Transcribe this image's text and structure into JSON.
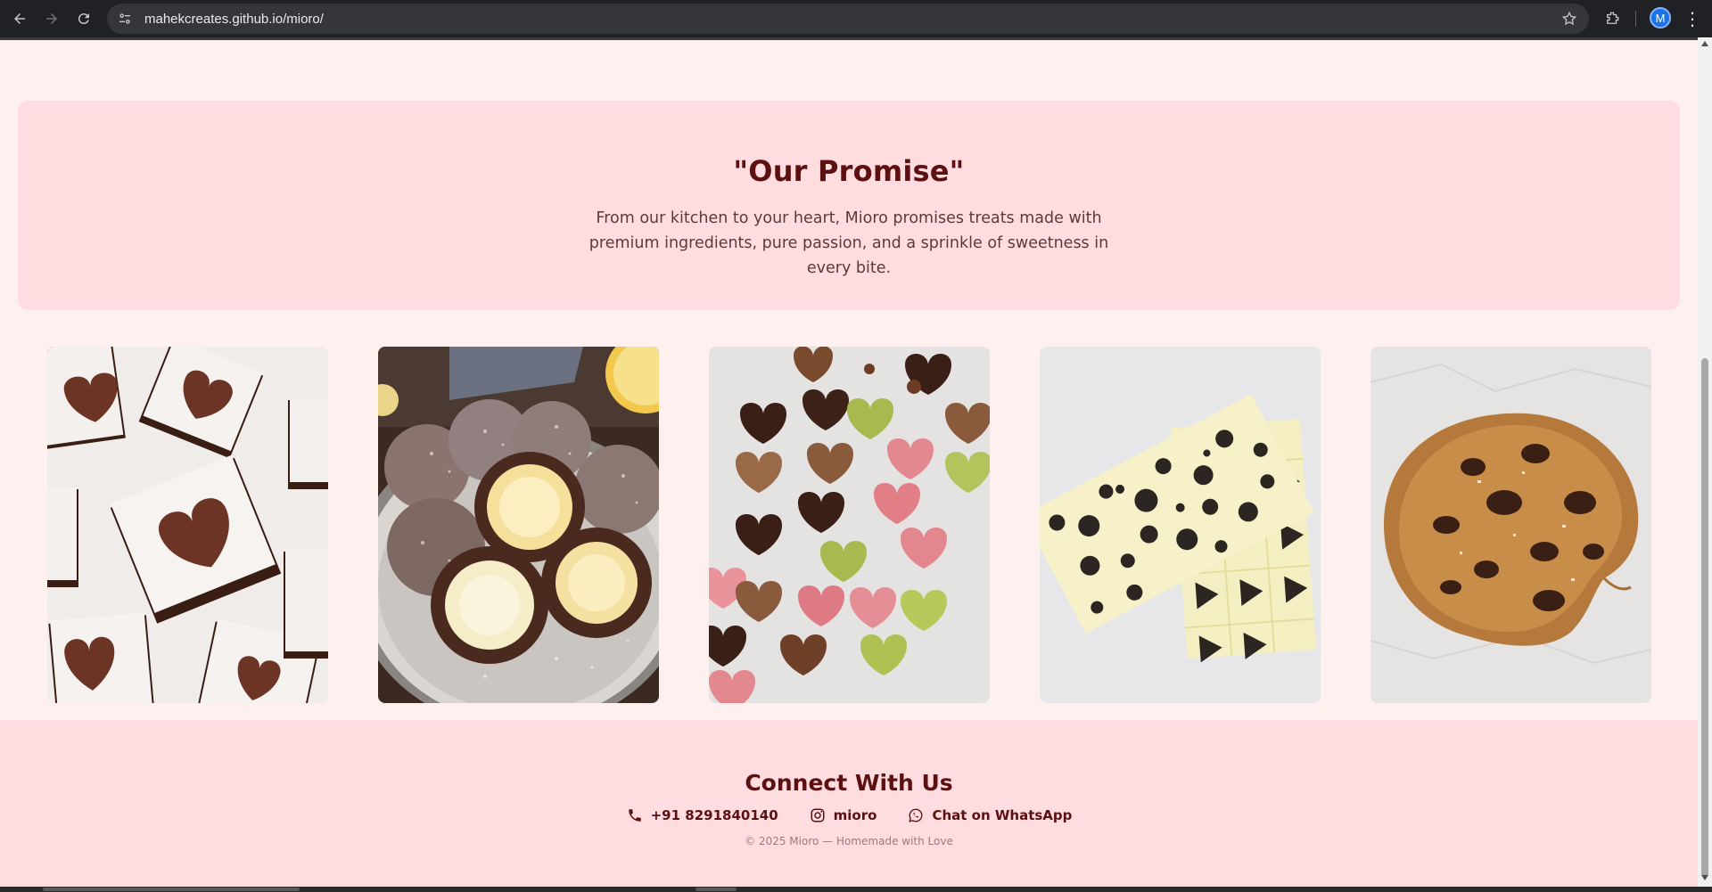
{
  "browser": {
    "url": "mahekcreates.github.io/mioro/",
    "profile_initial": "M"
  },
  "promise": {
    "title": "\"Our Promise\"",
    "text": "From our kitchen to your heart, Mioro promises treats made with premium ingredients, pure passion, and a sprinkle of sweetness in every bite."
  },
  "gallery": [
    {
      "name": "heart brownies"
    },
    {
      "name": "coconut truffles"
    },
    {
      "name": "heart chocolates"
    },
    {
      "name": "cookies and cream bar"
    },
    {
      "name": "chocolate chip cookie"
    }
  ],
  "footer": {
    "title": "Connect With Us",
    "phone": "+91 8291840140",
    "instagram": "mioro",
    "whatsapp": "Chat on WhatsApp",
    "copyright": "© 2025 Mioro — Homemade with Love"
  },
  "colors": {
    "page_bg": "#fff0f0",
    "panel_bg": "#ffdcdf",
    "heading": "#5c1010",
    "chrome": "#202124"
  }
}
